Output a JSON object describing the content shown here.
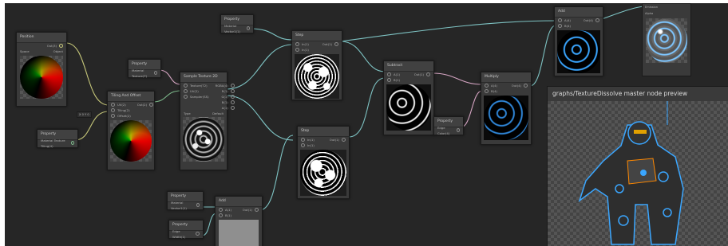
{
  "colors": {
    "canvas": "#262626",
    "wire_cyan": "#7ec3c3",
    "wire_yellow": "#c6c77a",
    "wire_green": "#7db98b",
    "wire_pink": "#d7a6c4",
    "glow_blue": "#39a7ff"
  },
  "nodes": {
    "position": {
      "title": "Position",
      "out": "Out(3)",
      "space": "Space",
      "space_value": "Object"
    },
    "property_a": {
      "title": "Property",
      "value": "Material Texture(T)"
    },
    "property_tiling": {
      "title": "Property",
      "value": "Material Texture Tiling(4)"
    },
    "tiling_offset": {
      "title": "Tiling And Offset",
      "in_uv": "UV(2)",
      "in_tiling": "Tiling(2)",
      "in_offset": "Offset(2)",
      "out": "Out(2)",
      "offset_value": "X  0   Y  0"
    },
    "sample_texture": {
      "title": "Sample Texture 2D",
      "in_texture": "Texture(T2)",
      "in_uv": "UV(2)",
      "in_sampler": "Sampler(SS)",
      "out_rgba": "RGBA(4)",
      "out_r": "R(1)",
      "out_g": "G(1)",
      "out_b": "B(1)",
      "out_a": "A(1)",
      "type_label": "Type",
      "type_value": "Default",
      "space_label": "Space",
      "space_value": "Tangent"
    },
    "step_top": {
      "title": "Step",
      "in_a": "In(1)",
      "in_b": "In(1)",
      "out": "Out(1)"
    },
    "step_bottom": {
      "title": "Step",
      "in_a": "In(1)",
      "in_b": "In(1)",
      "out": "Out(1)"
    },
    "property_top": {
      "title": "Property",
      "value": "Material Vector1(1)"
    },
    "property_mid": {
      "title": "Property",
      "value": "Material Vector1(1)"
    },
    "property_edge": {
      "title": "Property",
      "value": "Edge Width(1)"
    },
    "add": {
      "title": "Add",
      "in_a": "A(1)",
      "in_b": "B(1)",
      "out": "Out(1)"
    },
    "subtract": {
      "title": "Subtract",
      "in_a": "A(1)",
      "in_b": "B(1)",
      "out": "Out(1)"
    },
    "property_color": {
      "title": "Property",
      "value": "Edge Color(4)"
    },
    "multiply": {
      "title": "Multiply",
      "in_a": "A(4)",
      "in_b": "B(4)",
      "out": "Out(4)"
    },
    "add_top": {
      "title": "Add",
      "in_a": "A(4)",
      "in_b": "B(4)",
      "out": "Out(4)"
    }
  },
  "master": {
    "title": "graphs/TextureDissolve master node preview"
  },
  "top_right": {
    "row1": "Emission",
    "row2": "Alpha"
  }
}
